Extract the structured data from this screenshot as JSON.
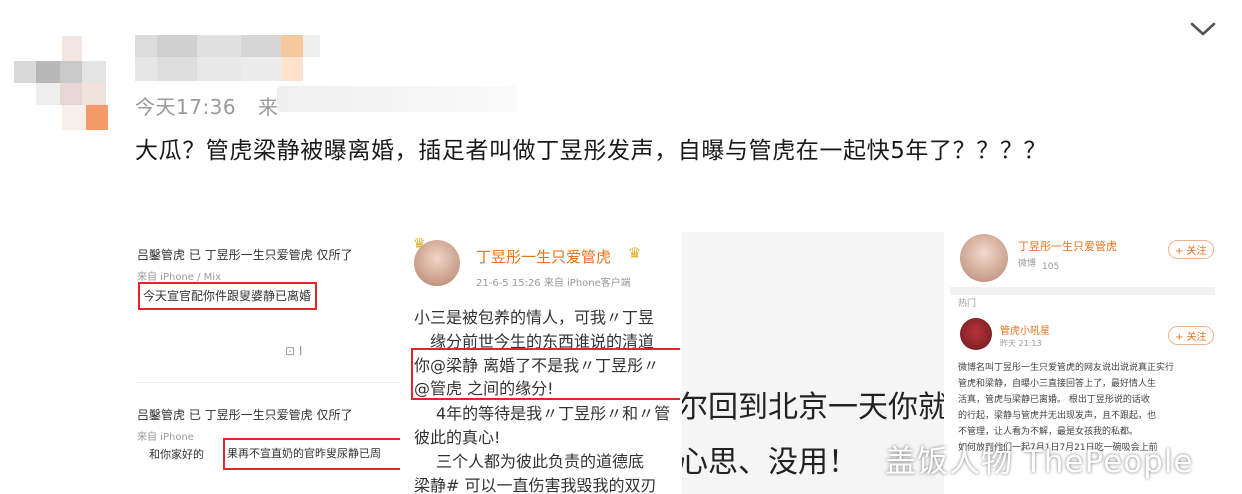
{
  "post": {
    "timestamp": "今天17:36",
    "source_prefix": "来",
    "text": "大瓜？管虎梁静被曝离婚，插足者叫做丁昱彤发声，自曝与管虎在一起快5年了？？？？"
  },
  "images": {
    "img1": {
      "header1": "吕鑿管虎 已 丁昱彤一生只爱管虎 仅所了",
      "meta1": "来自 iPhone / Mix",
      "highlight1": "今天宣官配你件跟叟婆静已离婚",
      "reply_icon": "⊡ I",
      "header2": "吕鑿管虎 已 丁昱彤一生只爱管虎 仅所了",
      "meta2": "来自 iPhone",
      "line2a": "和你家好的",
      "highlight2": "果再不宣直奶的官昨叟尿静已周"
    },
    "img2": {
      "author": "丁昱彤一生只爱管虎",
      "meta": "21-6-5 15:26  来自 iPhone客户端",
      "lines": [
        "小三是被包养的情人，可我〃丁昱",
        "缘分前世今生的东西谁说的清道",
        "你@梁静 离婚了不是我〃丁昱彤〃",
        "@管虎 之间的缘分!",
        "4年的等待是我〃丁昱彤〃和〃管",
        "彼此的真心!",
        "三个人都为彼此负责的道德底",
        "梁静# 可以一直伤害我毁我的双刃"
      ]
    },
    "img3": {
      "line1": "尔回到北京一天你就",
      "line2": "心思、没用！"
    },
    "img4": {
      "author": "丁昱彤一生只爱管虎",
      "meta": "微博",
      "count": "105",
      "follow": "+ 关注",
      "section": "热门",
      "repost_author": "管虎小吼星",
      "repost_meta": "昨天 21:13",
      "follow2": "+ 关注",
      "body": [
        "微博名叫丁昱彤一生只爱管虎的网友说出说说真正实行",
        "管虎和梁静，自曝小三直接回答上了，最好情人生",
        "活真，管虎与梁静已离婚。 根出丁昱彤说的话收",
        "的行起，梁静与管虎并无出现发声，且不跟起，也",
        "不管理，让人看为不解，最是女孩我的私都。",
        "如何放到他们一起7月1日7月21日吃一碗吸会上前"
      ]
    },
    "watermark": "盖饭人物 ThePeople"
  }
}
